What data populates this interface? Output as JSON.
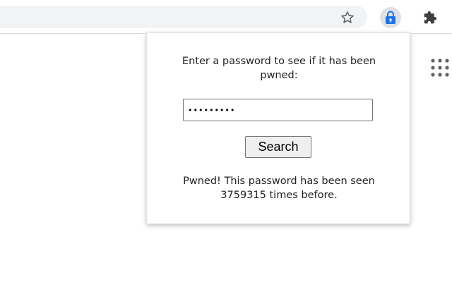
{
  "toolbar": {
    "icons": {
      "bookmark": "star-icon",
      "extension": "lock-icon",
      "extensions_menu": "puzzle-icon",
      "apps": "apps-grid-icon"
    },
    "colors": {
      "lock_icon": "#1a73e8",
      "omnibox_bg": "#f1f3f4"
    }
  },
  "popup": {
    "prompt": "Enter a password to see if it has been pwned:",
    "password_value": "•••••••••",
    "search_label": "Search",
    "result": "Pwned! This password has been seen 3759315 times before."
  }
}
